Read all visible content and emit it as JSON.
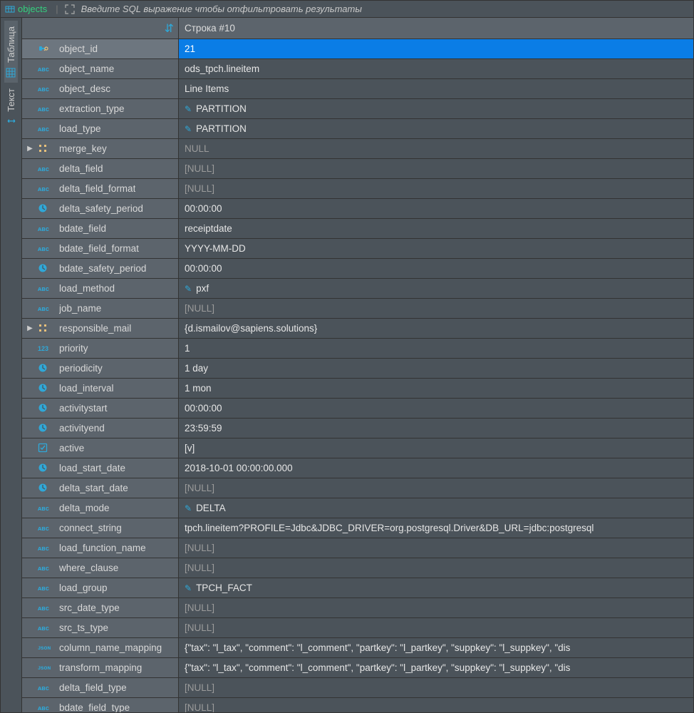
{
  "topbar": {
    "tab_label": "objects",
    "filter_placeholder": "Введите SQL выражение чтобы отфильтровать результаты"
  },
  "side_tabs": {
    "table": "Таблица",
    "text": "Текст"
  },
  "header": {
    "record_label": "Строка #10"
  },
  "fields": [
    {
      "name": "object_id",
      "type": "key",
      "value": "21",
      "selected": true
    },
    {
      "name": "object_name",
      "type": "abc",
      "value": "ods_tpch.lineitem"
    },
    {
      "name": "object_desc",
      "type": "abc",
      "value": "Line Items"
    },
    {
      "name": "extraction_type",
      "type": "abc",
      "value": "PARTITION",
      "link": true
    },
    {
      "name": "load_type",
      "type": "abc",
      "value": "PARTITION",
      "link": true
    },
    {
      "name": "merge_key",
      "type": "arr",
      "value": "NULL",
      "null": true,
      "expandable": true
    },
    {
      "name": "delta_field",
      "type": "abc",
      "value": "[NULL]",
      "null": true
    },
    {
      "name": "delta_field_format",
      "type": "abc",
      "value": "[NULL]",
      "null": true
    },
    {
      "name": "delta_safety_period",
      "type": "clock",
      "value": "00:00:00"
    },
    {
      "name": "bdate_field",
      "type": "abc",
      "value": "receiptdate"
    },
    {
      "name": "bdate_field_format",
      "type": "abc",
      "value": "YYYY-MM-DD"
    },
    {
      "name": "bdate_safety_period",
      "type": "clock",
      "value": "00:00:00"
    },
    {
      "name": "load_method",
      "type": "abc",
      "value": "pxf",
      "link": true
    },
    {
      "name": "job_name",
      "type": "abc",
      "value": "[NULL]",
      "null": true
    },
    {
      "name": "responsible_mail",
      "type": "arr",
      "value": "{d.ismailov@sapiens.solutions}",
      "expandable": true
    },
    {
      "name": "priority",
      "type": "num",
      "value": "1"
    },
    {
      "name": "periodicity",
      "type": "clock",
      "value": "1 day"
    },
    {
      "name": "load_interval",
      "type": "clock",
      "value": "1 mon"
    },
    {
      "name": "activitystart",
      "type": "clock",
      "value": "00:00:00"
    },
    {
      "name": "activityend",
      "type": "clock",
      "value": "23:59:59"
    },
    {
      "name": "active",
      "type": "chk",
      "value": "[v]"
    },
    {
      "name": "load_start_date",
      "type": "clock",
      "value": "2018-10-01 00:00:00.000"
    },
    {
      "name": "delta_start_date",
      "type": "clock",
      "value": "[NULL]",
      "null": true
    },
    {
      "name": "delta_mode",
      "type": "abc",
      "value": "DELTA",
      "link": true
    },
    {
      "name": "connect_string",
      "type": "abc",
      "value": "tpch.lineitem?PROFILE=Jdbc&JDBC_DRIVER=org.postgresql.Driver&DB_URL=jdbc:postgresql"
    },
    {
      "name": "load_function_name",
      "type": "abc",
      "value": "[NULL]",
      "null": true
    },
    {
      "name": "where_clause",
      "type": "abc",
      "value": "[NULL]",
      "null": true
    },
    {
      "name": "load_group",
      "type": "abc",
      "value": "TPCH_FACT",
      "link": true
    },
    {
      "name": "src_date_type",
      "type": "abc",
      "value": "[NULL]",
      "null": true
    },
    {
      "name": "src_ts_type",
      "type": "abc",
      "value": "[NULL]",
      "null": true
    },
    {
      "name": "column_name_mapping",
      "type": "json",
      "value": "{\"tax\": \"l_tax\", \"comment\": \"l_comment\", \"partkey\": \"l_partkey\", \"suppkey\": \"l_suppkey\", \"dis"
    },
    {
      "name": "transform_mapping",
      "type": "json",
      "value": "{\"tax\": \"l_tax\", \"comment\": \"l_comment\", \"partkey\": \"l_partkey\", \"suppkey\": \"l_suppkey\", \"dis"
    },
    {
      "name": "delta_field_type",
      "type": "abc",
      "value": "[NULL]",
      "null": true
    },
    {
      "name": "bdate_field_type",
      "type": "abc",
      "value": "[NULL]",
      "null": true
    }
  ]
}
